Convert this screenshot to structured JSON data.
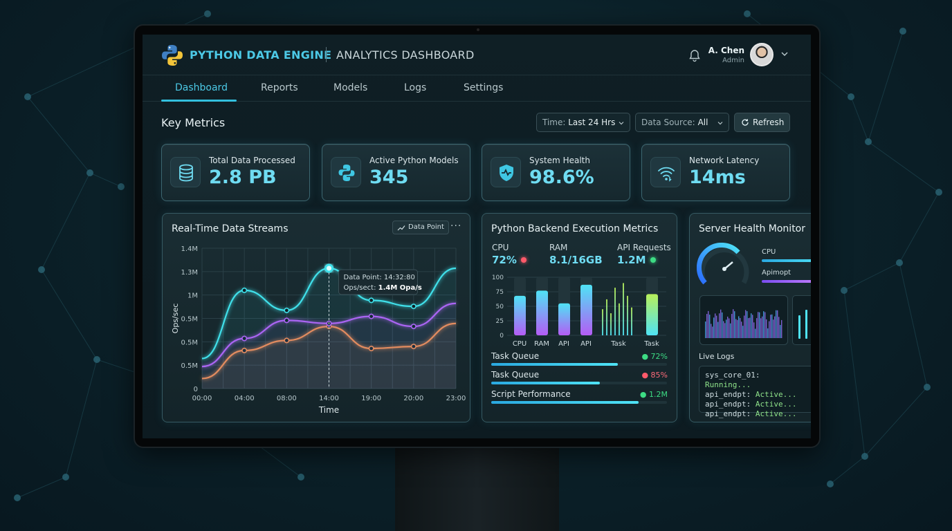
{
  "header": {
    "brand": "PYTHON DATA ENGINE",
    "title": "ANALYTICS DASHBOARD",
    "user_name": "A. Chen",
    "user_role": "Admin"
  },
  "tabs": [
    {
      "label": "Dashboard",
      "active": true
    },
    {
      "label": "Reports"
    },
    {
      "label": "Models"
    },
    {
      "label": "Logs"
    },
    {
      "label": "Settings"
    }
  ],
  "metrics": {
    "title": "Key Metrics",
    "time_label": "Time:",
    "time_value": "Last 24 Hrs",
    "source_label": "Data Source:",
    "source_value": "All",
    "refresh_label": "Refresh"
  },
  "cards": [
    {
      "label": "Total Data Processed",
      "value": "2.8 PB",
      "icon": "database-icon"
    },
    {
      "label": "Active Python Models",
      "value": "345",
      "icon": "python-icon"
    },
    {
      "label": "System Health",
      "value": "98.6%",
      "icon": "shield-heartbeat-icon"
    },
    {
      "label": "Network Latency",
      "value": "14ms",
      "icon": "wifi-icon"
    }
  ],
  "streams": {
    "title": "Real-Time Data Streams",
    "button_label": "Data Point",
    "tooltip_line1": "Data Point: 14:32:80",
    "tooltip_label": "Ops/sect:",
    "tooltip_value": "1.4M Opa/s"
  },
  "chart_data": {
    "type": "line",
    "xlabel": "Time",
    "ylabel": "Ops/sec",
    "x_ticks": [
      "00:00",
      "04:00",
      "08:00",
      "14:00",
      "19:00",
      "20:00",
      "23:00"
    ],
    "y_ticks": [
      "0",
      "0.5M",
      "0.5M",
      "0.5M",
      "1M",
      "1.3M",
      "1.4M"
    ],
    "ylim": [
      0,
      1.4
    ],
    "grid": true,
    "x": [
      0,
      1,
      2,
      3,
      4,
      5,
      6
    ],
    "series": [
      {
        "color": "#3fe0ea",
        "values": [
          0.3,
          0.98,
          0.78,
          1.2,
          0.88,
          0.82,
          1.2
        ]
      },
      {
        "color": "#b45cf5",
        "values": [
          0.22,
          0.5,
          0.68,
          0.65,
          0.72,
          0.62,
          0.85
        ]
      },
      {
        "color": "#f58a4a",
        "values": [
          0.1,
          0.38,
          0.48,
          0.62,
          0.4,
          0.42,
          0.65
        ]
      }
    ]
  },
  "backend": {
    "title": "Python Backend Execution Metrics",
    "cpu_label": "CPU",
    "cpu_value": "72%",
    "ram_label": "RAM",
    "ram_value": "8.1/16GB",
    "api_label": "API Requests",
    "api_value": "1.2M",
    "bars_y_ticks": [
      "100",
      "75",
      "50",
      "25",
      "0"
    ],
    "bars": [
      {
        "label": "CPU",
        "value": 68
      },
      {
        "label": "RAM",
        "value": 77
      },
      {
        "label": "API",
        "value": 55
      },
      {
        "label": "API",
        "value": 87
      },
      {
        "label": "Task",
        "value": 80
      },
      {
        "label": "Task",
        "value": 71
      }
    ],
    "queues": [
      {
        "label": "Task Queue",
        "value": "72%",
        "fill": 0.72,
        "status": "#3ddc84"
      },
      {
        "label": "Task Queue",
        "value": "85%",
        "fill": 0.62,
        "status": "#ff5a6a"
      },
      {
        "label": "Script Performance",
        "value": "1.2M",
        "fill": 0.84,
        "status": "#3ddc84"
      }
    ]
  },
  "server": {
    "title": "Server Health Monitor",
    "cpu_label": "CPU",
    "api_label": "Apimopt",
    "cpu_fill": 0.9,
    "api_fill": 0.78,
    "logs_title": "Live Logs",
    "logs": [
      {
        "key": "sys_core_01:",
        "status": "Running..."
      },
      {
        "key": "api_endpt:",
        "status": "Active..."
      },
      {
        "key": "api_endpt:",
        "status": "Active..."
      },
      {
        "key": "api_endpt:",
        "status": "Active..."
      }
    ]
  }
}
